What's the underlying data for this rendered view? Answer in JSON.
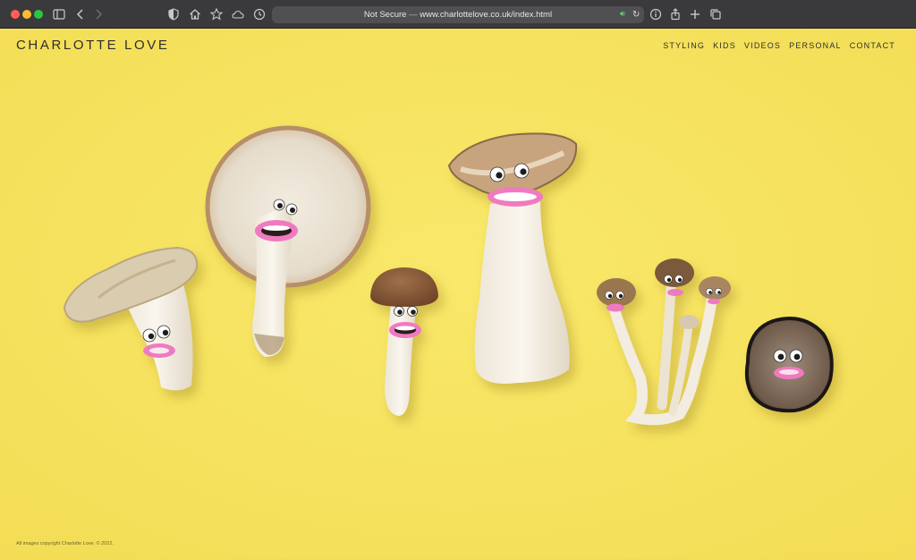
{
  "browser": {
    "url_prefix": "Not Secure",
    "url_separator": "—",
    "url": "www.charlottelove.co.uk/index.html"
  },
  "site": {
    "title": "CHARLOTTE LOVE",
    "nav": [
      "STYLING",
      "KIDS",
      "VIDEOS",
      "PERSONAL",
      "CONTACT"
    ],
    "footer": "All images copyright Charlotte Love. © 2022."
  },
  "colors": {
    "background": "#f6e35f",
    "text": "#2e2e2e",
    "lip_pink": "#f07ac0"
  },
  "hero_image": {
    "subjects": [
      "oyster-mushroom",
      "flat-cap-mushroom",
      "chestnut-mushroom",
      "king-oyster-mushroom",
      "shimeji-mushroom-cluster",
      "truffle"
    ]
  }
}
